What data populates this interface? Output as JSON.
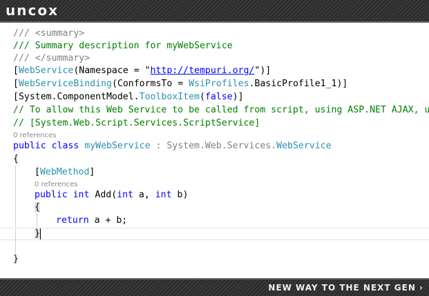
{
  "brand": {
    "logo": "uncox",
    "tagline": "NEW WAY TO THE NEXT GEN ›"
  },
  "code": {
    "l1": "/// <summary>",
    "l2": "/// Summary description for myWebService",
    "l3": "/// </summary>",
    "l4": {
      "open": "[",
      "attr": "WebService",
      "mid": "(Namespace = \"",
      "url": "http://tempuri.org/",
      "close": "\")]"
    },
    "l5": {
      "open": "[",
      "attr": "WebServiceBinding",
      "mid": "(ConformsTo = ",
      "type": "WsiProfiles",
      "rest": ".BasicProfile1_1)]"
    },
    "l6": {
      "open": "[System.ComponentModel.",
      "attr": "ToolboxItem",
      "p1": "(",
      "kw": "false",
      "close": ")]"
    },
    "l7": "// To allow this Web Service to be called from script, using ASP.NET AJAX, uncomment the following line.",
    "l8": "// [System.Web.Script.Services.ScriptService]",
    "ref1": "0 references",
    "l9": {
      "kw1": "public",
      "kw2": "class",
      "name": "myWebService",
      "sep": " : System.Web.Services.",
      "base": "WebService"
    },
    "l10": "{",
    "l11": {
      "open": "[",
      "attr": "WebMethod",
      "close": "]"
    },
    "ref2": "0 references",
    "l12": {
      "kw1": "public",
      "kw2": "int",
      "name": "Add(",
      "kw3": "int",
      "p1": " a, ",
      "kw4": "int",
      "p2": " b)"
    },
    "l13": "{",
    "l14": {
      "kw": "return",
      "rest": " a + b;"
    },
    "l15": "}",
    "l16": "}"
  },
  "colors": {
    "comment": "#008000",
    "keyword": "#0000ff",
    "type": "#2b91af",
    "string": "#a31515",
    "codelens": "#8a8a8a"
  }
}
